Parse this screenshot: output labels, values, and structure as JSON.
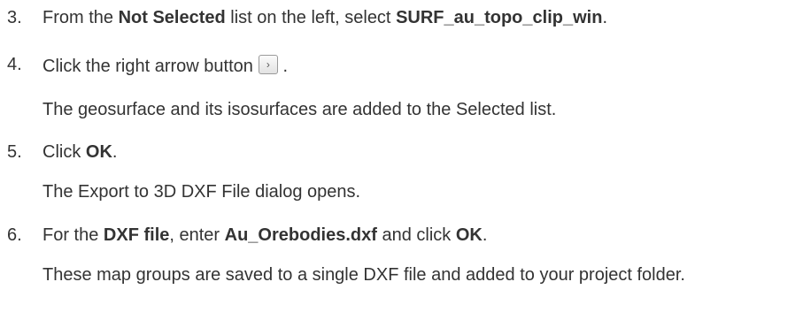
{
  "steps": [
    {
      "number": "3.",
      "text_a": "From the ",
      "bold_a": "Not Selected",
      "text_b": " list on the left, select ",
      "bold_b": "SURF_au_topo_clip_win",
      "text_c": "."
    },
    {
      "number": "4.",
      "text_a": "Click the right arrow button",
      "button_glyph": "›",
      "text_b": " .",
      "result": "The geosurface and its isosurfaces are added to the Selected list."
    },
    {
      "number": "5.",
      "text_a": "Click ",
      "bold_a": "OK",
      "text_b": ".",
      "result": "The Export to 3D DXF File dialog opens."
    },
    {
      "number": "6.",
      "text_a": "For the ",
      "bold_a": "DXF file",
      "text_b": ", enter ",
      "bold_b": "Au_Orebodies.dxf",
      "text_c": " and click ",
      "bold_c": "OK",
      "text_d": ".",
      "result": "These map groups are saved to a single DXF file and added to your project folder."
    }
  ]
}
